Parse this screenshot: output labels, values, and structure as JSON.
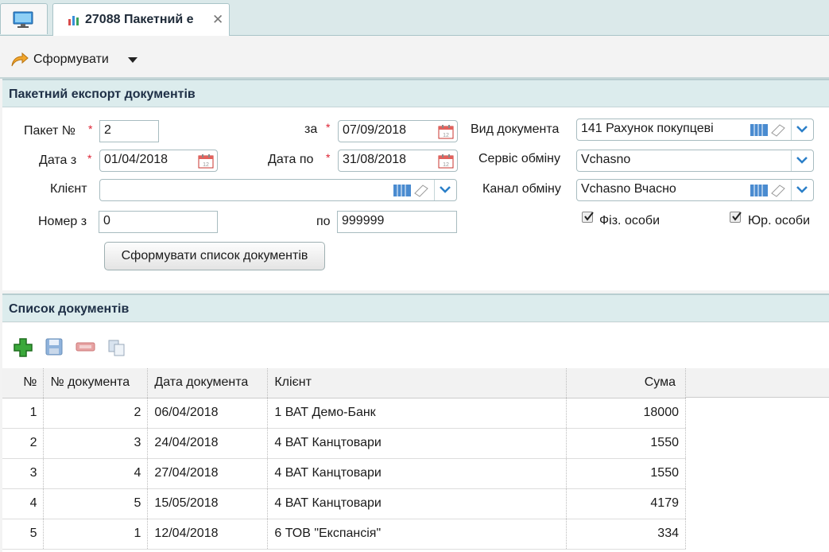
{
  "tabs": {
    "doc_title": "27088 Пакетний е"
  },
  "toolbar": {
    "form_label": "Сформувати"
  },
  "export_panel": {
    "title": "Пакетний експорт документів",
    "packet_label": "Пакет №",
    "packet_value": "2",
    "za_label": "за",
    "za_value": "07/09/2018",
    "doc_type_label": "Вид документа",
    "doc_type_value": "141 Рахунок покупцеві",
    "date_from_label": "Дата з",
    "date_from_value": "01/04/2018",
    "date_to_label": "Дата по",
    "date_to_value": "31/08/2018",
    "service_label": "Сервіс обміну",
    "service_value": "Vchasno",
    "client_label": "Клієнт",
    "client_value": "",
    "channel_label": "Канал обміну",
    "channel_value": "Vchasno Вчасно",
    "number_from_label": "Номер з",
    "number_from_value": "0",
    "number_to_label": "по",
    "number_to_value": "999999",
    "fiz_label": "Фіз. особи",
    "fiz_checked": true,
    "yur_label": "Юр. особи",
    "yur_checked": true,
    "build_button": "Сформувати список документів"
  },
  "list_panel": {
    "title": "Список документів",
    "columns": [
      "№",
      "№ документа",
      "Дата документа",
      "Клієнт",
      "Сума"
    ],
    "rows": [
      [
        "1",
        "2",
        "06/04/2018",
        "1 ВАТ Демо-Банк",
        "18000"
      ],
      [
        "2",
        "3",
        "24/04/2018",
        "4 ВАТ Канцтовари",
        "1550"
      ],
      [
        "3",
        "4",
        "27/04/2018",
        "4 ВАТ Канцтовари",
        "1550"
      ],
      [
        "4",
        "5",
        "15/05/2018",
        "4 ВАТ Канцтовари",
        "4179"
      ],
      [
        "5",
        "1",
        "12/04/2018",
        "6 ТОВ \"Експансія\"",
        "334"
      ]
    ]
  },
  "icons": [
    "monitor-icon",
    "chart-icon",
    "close-icon",
    "arrow-icon",
    "caret-down-icon",
    "calendar-icon",
    "directory-icon",
    "eraser-icon",
    "chevron-down-icon",
    "add-icon",
    "save-icon",
    "delete-icon",
    "copy-icon"
  ],
  "colors": {
    "header_bg": "#dceced",
    "accent": "#2a7fc8",
    "add_green": "#2e9a2e",
    "delete_red": "#d94a4a"
  }
}
